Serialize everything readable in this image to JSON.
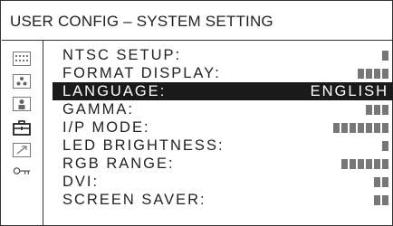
{
  "header": {
    "title": "USER CONFIG – SYSTEM SETTING"
  },
  "sidebar": {
    "icons": [
      "dots-grid-icon",
      "dot-cluster-icon",
      "person-icon",
      "toolbox-icon",
      "arrow-icon",
      "key-icon"
    ]
  },
  "menu": {
    "items": [
      {
        "label": "NTSC SETUP:",
        "value": "",
        "masked_length": 1,
        "selected": false
      },
      {
        "label": "FORMAT DISPLAY:",
        "value": "",
        "masked_length": 4,
        "selected": false
      },
      {
        "label": "LANGUAGE:",
        "value": "ENGLISH",
        "masked_length": 0,
        "selected": true
      },
      {
        "label": "GAMMA:",
        "value": "",
        "masked_length": 3,
        "selected": false
      },
      {
        "label": "I/P MODE:",
        "value": "",
        "masked_length": 7,
        "selected": false
      },
      {
        "label": "LED BRIGHTNESS:",
        "value": "",
        "masked_length": 1,
        "selected": false
      },
      {
        "label": "RGB RANGE:",
        "value": "",
        "masked_length": 6,
        "selected": false
      },
      {
        "label": "DVI:",
        "value": "",
        "masked_length": 2,
        "selected": false
      },
      {
        "label": "SCREEN SAVER:",
        "value": "",
        "masked_length": 2,
        "selected": false
      }
    ]
  },
  "colors": {
    "selected_bg": "#1a1a1a",
    "mask_block": "#777777",
    "frame": "#333333"
  }
}
